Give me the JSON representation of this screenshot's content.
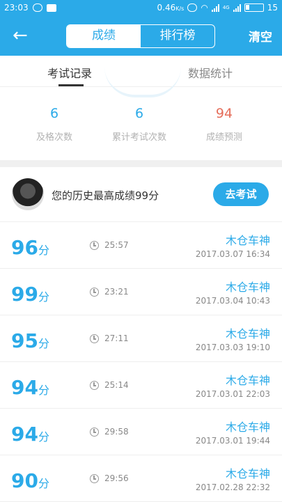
{
  "status_bar": {
    "time": "23:03",
    "speed": "0.46",
    "speed_unit": "K/s",
    "network": "4G",
    "battery": "15"
  },
  "header": {
    "tabs": [
      "成绩",
      "排行榜"
    ],
    "clear_label": "清空"
  },
  "sub_tabs": [
    "考试记录",
    "数据统计"
  ],
  "stats": [
    {
      "value": "6",
      "label": "及格次数"
    },
    {
      "value": "6",
      "label": "累计考试次数"
    },
    {
      "value": "94",
      "label": "成绩预测"
    }
  ],
  "best": {
    "text": "您的历史最高成绩99分",
    "button": "去考试"
  },
  "records": [
    {
      "score": "96",
      "unit": "分",
      "duration": "25:57",
      "name": "木仓车神",
      "date": "2017.03.07  16:34"
    },
    {
      "score": "99",
      "unit": "分",
      "duration": "23:21",
      "name": "木仓车神",
      "date": "2017.03.04  10:43"
    },
    {
      "score": "95",
      "unit": "分",
      "duration": "27:11",
      "name": "木仓车神",
      "date": "2017.03.03  19:10"
    },
    {
      "score": "94",
      "unit": "分",
      "duration": "25:14",
      "name": "木仓车神",
      "date": "2017.03.01  22:03"
    },
    {
      "score": "94",
      "unit": "分",
      "duration": "29:58",
      "name": "木仓车神",
      "date": "2017.03.01  19:44"
    },
    {
      "score": "90",
      "unit": "分",
      "duration": "29:56",
      "name": "木仓车神",
      "date": "2017.02.28  22:32"
    }
  ],
  "colors": {
    "accent": "#2baae8",
    "prediction": "#e56e5b"
  }
}
